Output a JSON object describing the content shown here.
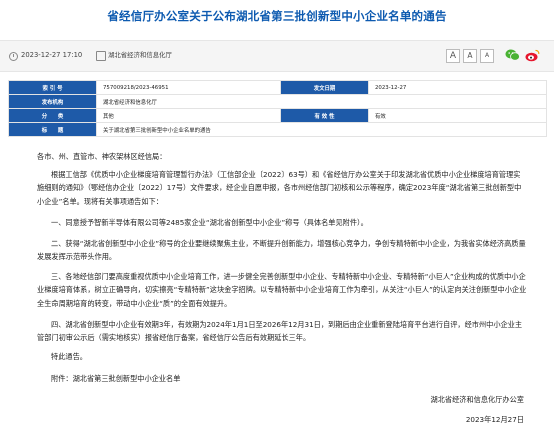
{
  "title": "省经信厅办公室关于公布湖北省第三批创新型中小企业名单的通告",
  "meta": {
    "date": "2023-12-27 17:10",
    "source": "湖北省经济和信息化厅",
    "font_large": "A",
    "font_medium": "A",
    "font_small": "A",
    "share_wechat": "wechat",
    "share_weibo": "weibo"
  },
  "info_table": {
    "row1": {
      "label1": "索 引 号",
      "value1": "757009218/2023-46951",
      "label2": "发文日期",
      "value2": "2023-12-27"
    },
    "row2": {
      "label1": "发布机构",
      "value1": "湖北省经济和信息化厅"
    },
    "row3": {
      "label1": "分　　类",
      "value1": "其他",
      "label2": "有 效 性",
      "value2": "有效"
    },
    "row4": {
      "label1": "标　　题",
      "value1": "关于湖北省第三批创新型中小企业名单的通告"
    }
  },
  "content": {
    "salutation": "各市、州、直管市、神农架林区经信局：",
    "para1": "根据工信部《优质中小企业梯度培育管理暂行办法》（工信部企业〔2022〕63号）和《省经信厅办公室关于印发湖北省优质中小企业梯度培育管理实施细则的通知》（鄂经信办企业〔2022〕17号）文件要求，经企业自愿申报，各市州经信部门初核和公示等程序，确定2023年度“湖北省第三批创新型中小企业”名单。现将有关事项通告如下：",
    "para2": "一、同意授予智新半导体有限公司等2485家企业“湖北省创新型中小企业”称号（具体名单见附件）。",
    "para3": "二、获得“湖北省创新型中小企业”称号的企业要继续聚焦主业，不断提升创新能力，增强核心竞争力，争创专精特新中小企业，为我省实体经济高质量发展发挥示范带头作用。",
    "para4": "三、各地经信部门要高度重视优质中小企业培育工作，进一步健全完善创新型中小企业、专精特新中小企业、专精特新“小巨人”企业构成的优质中小企业梯度培育体系，树立正确导向，切实擦亮“专精特新”这块金字招牌。以专精特新中小企业培育工作为牵引，从关注“小巨人”的认定向关注创新型中小企业全生命周期培育的转变，带动中小企业“质”的全面有效提升。",
    "para5": "四、湖北省创新型中小企业有效期3年，有效期为2024年1月1日至2026年12月31日，到期后由企业重新登陆培育平台进行自评，经市州中小企业主管部门初审公示后（需实地核实）报省经信厅备案，省经信厅公告后有效期延长三年。",
    "para6": "特此通告。",
    "attachment": "附件：湖北省第三批创新型中小企业名单",
    "issuer": "湖北省经济和信息化厅办公室",
    "sign_date": "2023年12月27日"
  }
}
